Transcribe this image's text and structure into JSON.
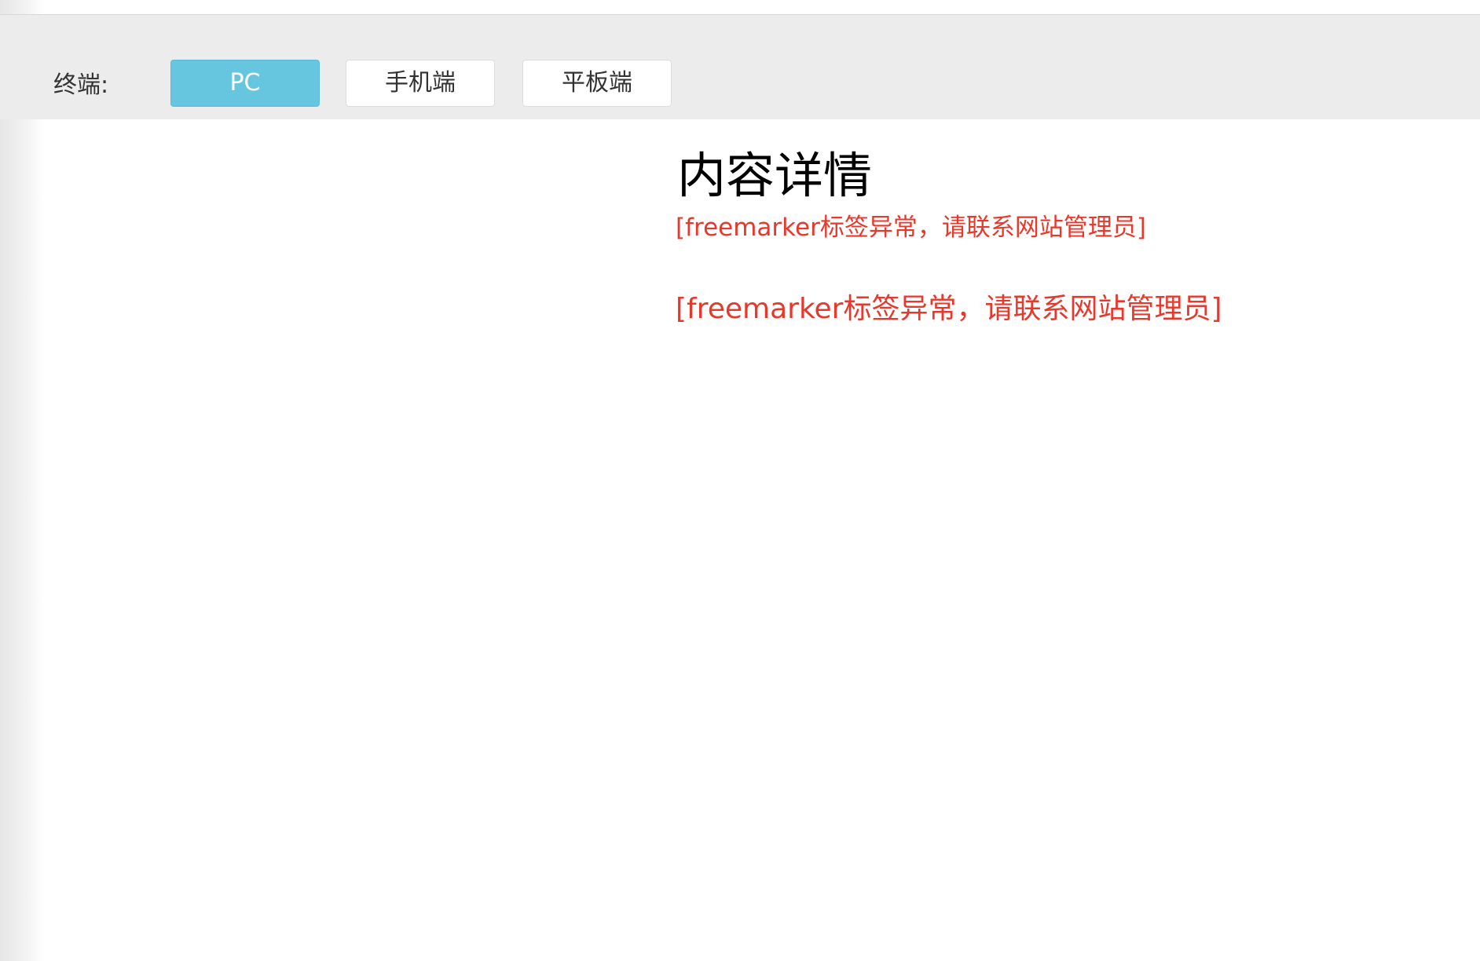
{
  "toolbar": {
    "terminal_label": "终端:",
    "buttons": [
      {
        "label": "PC",
        "active": true
      },
      {
        "label": "手机端",
        "active": false
      },
      {
        "label": "平板端",
        "active": false
      }
    ]
  },
  "main": {
    "title": "内容详情",
    "errors": [
      "[freemarker标签异常，请联系网站管理员]",
      "[freemarker标签异常，请联系网站管理员]"
    ]
  },
  "colors": {
    "active_button": "#66c5df",
    "error_text": "#e8382b",
    "toolbar_bg": "#ececec"
  }
}
